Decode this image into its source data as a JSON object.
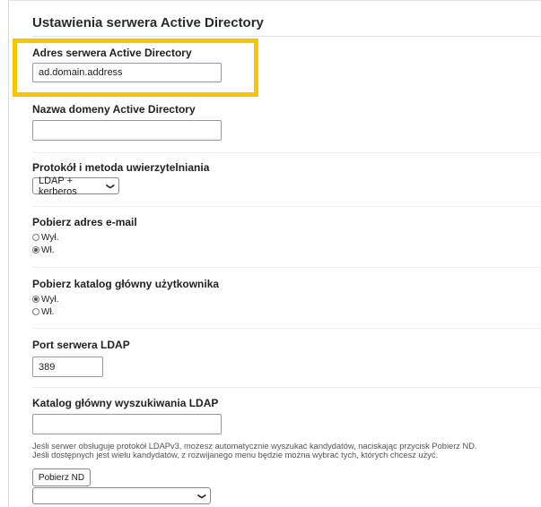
{
  "section": {
    "title": "Ustawienia serwera Active Directory"
  },
  "fields": {
    "server_address": {
      "label": "Adres serwera Active Directory",
      "value": "ad.domain.address"
    },
    "domain_name": {
      "label": "Nazwa domeny Active Directory",
      "value": ""
    },
    "auth": {
      "label": "Protokół i metoda uwierzytelniania",
      "selected": "LDAP + kerberos"
    },
    "email": {
      "label": "Pobierz adres e-mail",
      "options": [
        "Wył.",
        "Wł."
      ],
      "selected_index": 1
    },
    "home_dir": {
      "label": "Pobierz katalog główny użytkownika",
      "options": [
        "Wył.",
        "Wł."
      ],
      "selected_index": 0
    },
    "ldap_port": {
      "label": "Port serwera LDAP",
      "value": "389"
    },
    "ldap_root": {
      "label": "Katalog główny wyszukiwania LDAP",
      "value": "",
      "help_line1": "Jeśli serwer obsługuje protokół LDAPv3, możesz automatycznie wyszukać kandydatów, naciskając przycisk Pobierz ND.",
      "help_line2": "Jeśli dostępnych jest wielu kandydatów, z rozwijanego menu będzie można wybrać tych, których chcesz użyć.",
      "fetch_button": "Pobierz ND",
      "candidates_selected": ""
    }
  },
  "colors": {
    "highlight": "#f9c400"
  },
  "icons": {
    "select_chevron": "chevron-down-icon"
  }
}
